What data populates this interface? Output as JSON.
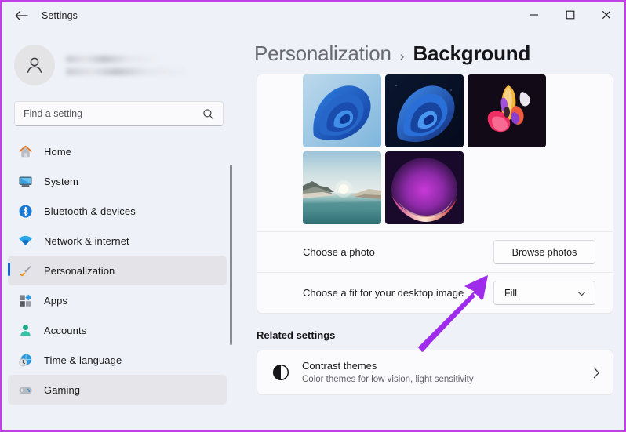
{
  "window": {
    "title": "Settings",
    "back_icon": "back-arrow-icon",
    "minimize_label": "—",
    "maximize_label": "□",
    "close_label": "✕"
  },
  "profile": {
    "avatar_icon": "person-avatar-icon",
    "name_redacted": "",
    "email_redacted": ""
  },
  "search": {
    "placeholder": "Find a setting",
    "value": "",
    "icon": "search-icon"
  },
  "sidebar": {
    "items": [
      {
        "label": "Home",
        "icon": "home-icon",
        "selected": false,
        "hover": false
      },
      {
        "label": "System",
        "icon": "system-icon",
        "selected": false,
        "hover": false
      },
      {
        "label": "Bluetooth & devices",
        "icon": "bluetooth-icon",
        "selected": false,
        "hover": false
      },
      {
        "label": "Network & internet",
        "icon": "wifi-icon",
        "selected": false,
        "hover": false
      },
      {
        "label": "Personalization",
        "icon": "paintbrush-icon",
        "selected": true,
        "hover": false
      },
      {
        "label": "Apps",
        "icon": "apps-icon",
        "selected": false,
        "hover": false
      },
      {
        "label": "Accounts",
        "icon": "accounts-icon",
        "selected": false,
        "hover": false
      },
      {
        "label": "Time & language",
        "icon": "clock-globe-icon",
        "selected": false,
        "hover": false
      },
      {
        "label": "Gaming",
        "icon": "gamepad-icon",
        "selected": false,
        "hover": true
      }
    ]
  },
  "breadcrumb": {
    "parent": "Personalization",
    "separator": "›",
    "current": "Background"
  },
  "background": {
    "thumbnails": [
      {
        "name": "windows-bloom-light"
      },
      {
        "name": "windows-bloom-dark"
      },
      {
        "name": "abstract-flower"
      },
      {
        "name": "coastal-sunset"
      },
      {
        "name": "purple-glow"
      }
    ],
    "choose_photo_label": "Choose a photo",
    "browse_button_label": "Browse photos",
    "choose_fit_label": "Choose a fit for your desktop image",
    "fit_value": "Fill",
    "fit_chevron_icon": "chevron-down-icon"
  },
  "related": {
    "heading": "Related settings",
    "item_title": "Contrast themes",
    "item_subtitle": "Color themes for low vision, light sensitivity",
    "item_icon": "contrast-circle-icon",
    "chevron_icon": "chevron-right-icon"
  },
  "annotation": {
    "arrow_icon": "pointer-arrow-icon",
    "color": "#a02ceb"
  },
  "colors": {
    "accent": "#0f66d0",
    "window_bg": "#eef1f7",
    "card_bg": "#fbfbfd",
    "frame_border": "#c040e8"
  }
}
